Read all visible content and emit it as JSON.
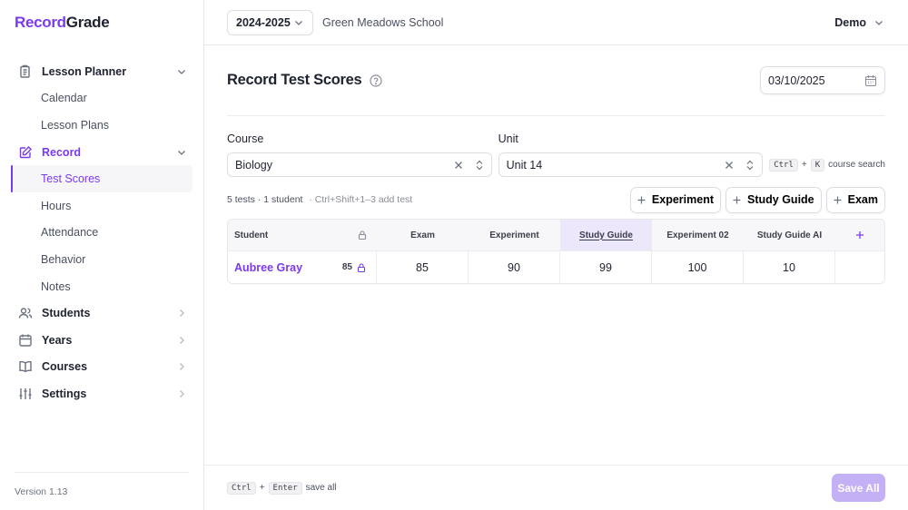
{
  "brand": {
    "part1": "Record",
    "part2": "Grade"
  },
  "sidebar": {
    "items": [
      {
        "label": "Lesson Planner",
        "icon": "clipboard-icon"
      },
      {
        "label": "Calendar"
      },
      {
        "label": "Lesson Plans"
      },
      {
        "label": "Record",
        "icon": "pencil-square-icon"
      },
      {
        "label": "Test Scores"
      },
      {
        "label": "Hours"
      },
      {
        "label": "Attendance"
      },
      {
        "label": "Behavior"
      },
      {
        "label": "Notes"
      },
      {
        "label": "Students",
        "icon": "users-icon"
      },
      {
        "label": "Years",
        "icon": "calendar-icon"
      },
      {
        "label": "Courses",
        "icon": "book-icon"
      },
      {
        "label": "Settings",
        "icon": "sliders-icon"
      }
    ],
    "version": "Version 1.13"
  },
  "header": {
    "year": "2024-2025",
    "school": "Green Meadows School",
    "user": "Demo"
  },
  "page": {
    "title": "Record Test Scores",
    "date": "03/10/2025"
  },
  "filters": {
    "course_label": "Course",
    "course_value": "Biology",
    "unit_label": "Unit",
    "unit_value": "Unit 14",
    "hint_key1": "Ctrl",
    "hint_plus": "+",
    "hint_key2": "K",
    "hint_text": "course search"
  },
  "toolbar": {
    "meta": "5 tests · 1 student",
    "shortcut": "· Ctrl+Shift+1–3 add test",
    "buttons": [
      "Experiment",
      "Study Guide",
      "Exam"
    ]
  },
  "grid": {
    "student_header": "Student",
    "columns": [
      "Exam",
      "Experiment",
      "Study Guide",
      "Experiment 02",
      "Study Guide AI"
    ],
    "rows": [
      {
        "name": "Aubree Gray",
        "avg": "85",
        "scores": [
          "85",
          "90",
          "99",
          "100",
          "10"
        ]
      }
    ]
  },
  "footer": {
    "key1": "Ctrl",
    "plus": "+",
    "key2": "Enter",
    "text": "save all",
    "save_label": "Save All"
  },
  "colors": {
    "accent": "#7c3aed",
    "save_disabled": "#c4b0f5",
    "selected_col": "#ece7fb"
  }
}
